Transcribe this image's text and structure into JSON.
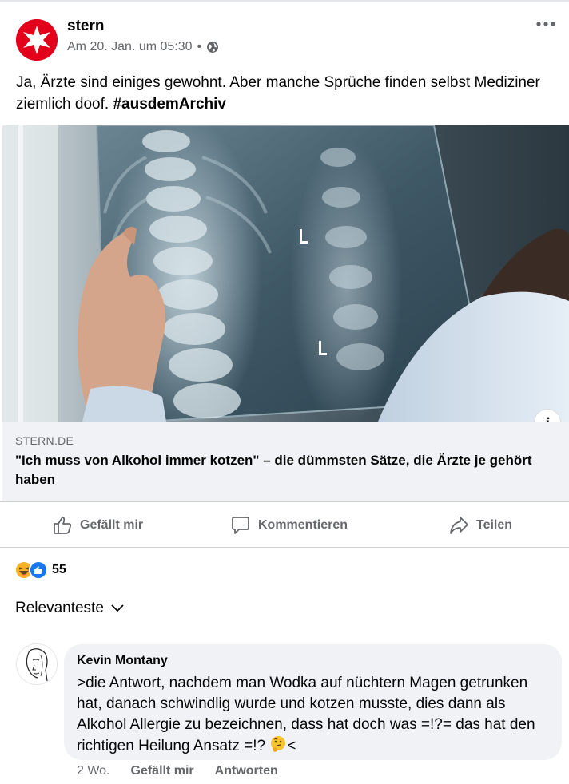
{
  "post": {
    "page_name": "stern",
    "timestamp": "Am 20. Jan. um 05:30",
    "separator": "•",
    "text": "Ja, Ärzte sind einiges gewohnt. Aber manche Sprüche finden selbst Mediziner ziemlich doof. ",
    "hashtag": "#ausdemArchiv"
  },
  "link_preview": {
    "domain": "STERN.DE",
    "title": "\"Ich muss von Alkohol immer kotzen\" – die dümmsten Sätze, die Ärzte je gehört haben",
    "info_label": "i"
  },
  "actions": {
    "like": "Gefällt mir",
    "comment": "Kommentieren",
    "share": "Teilen"
  },
  "reactions": {
    "count": "55",
    "types": [
      "haha",
      "like"
    ]
  },
  "comments_sort": {
    "label": "Relevanteste"
  },
  "comment": {
    "author": "Kevin Montany",
    "text": ">die Antwort, nachdem man Wodka auf nüchtern Magen getrunken hat, danach schwindlig wurde und kotzen musste, dies dann als Alkohol Allergie zu bezeichnen, dass hat doch was =!?= das hat den richtigen Heilung Ansatz =!? ",
    "text_end": "<",
    "age": "2 Wo.",
    "like": "Gefällt mir",
    "reply": "Antworten"
  },
  "colors": {
    "brand_red": "#e2001a",
    "like_blue": "#1877f2",
    "muted_text": "#65676b",
    "link_preview_bg": "#f0f2f5"
  }
}
